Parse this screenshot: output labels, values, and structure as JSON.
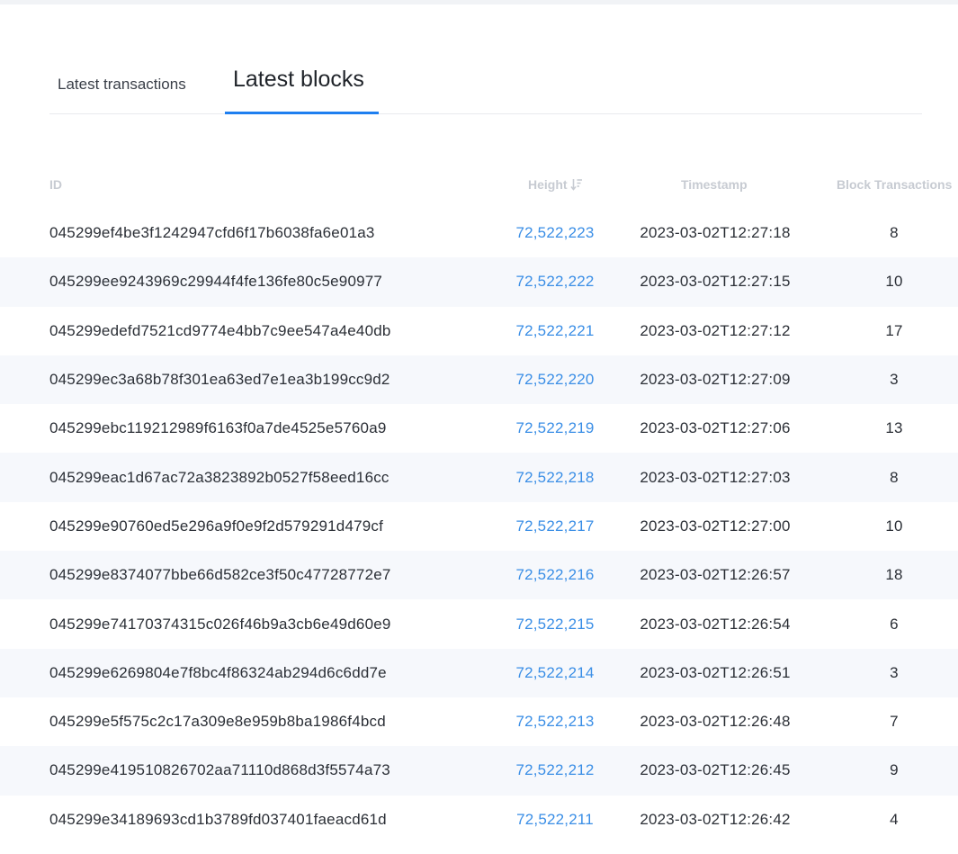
{
  "tabs": {
    "transactions_label": "Latest transactions",
    "blocks_label": "Latest blocks",
    "active": "blocks"
  },
  "table": {
    "headers": {
      "id": "ID",
      "height": "Height",
      "timestamp": "Timestamp",
      "transactions": "Block Transactions"
    },
    "sort_icon": "sort-descending-icon",
    "rows": [
      {
        "id": "045299ef4be3f1242947cfd6f17b6038fa6e01a3",
        "height": "72,522,223",
        "timestamp": "2023-03-02T12:27:18",
        "tx": "8"
      },
      {
        "id": "045299ee9243969c29944f4fe136fe80c5e90977",
        "height": "72,522,222",
        "timestamp": "2023-03-02T12:27:15",
        "tx": "10"
      },
      {
        "id": "045299edefd7521cd9774e4bb7c9ee547a4e40db",
        "height": "72,522,221",
        "timestamp": "2023-03-02T12:27:12",
        "tx": "17"
      },
      {
        "id": "045299ec3a68b78f301ea63ed7e1ea3b199cc9d2",
        "height": "72,522,220",
        "timestamp": "2023-03-02T12:27:09",
        "tx": "3"
      },
      {
        "id": "045299ebc119212989f6163f0a7de4525e5760a9",
        "height": "72,522,219",
        "timestamp": "2023-03-02T12:27:06",
        "tx": "13"
      },
      {
        "id": "045299eac1d67ac72a3823892b0527f58eed16cc",
        "height": "72,522,218",
        "timestamp": "2023-03-02T12:27:03",
        "tx": "8"
      },
      {
        "id": "045299e90760ed5e296a9f0e9f2d579291d479cf",
        "height": "72,522,217",
        "timestamp": "2023-03-02T12:27:00",
        "tx": "10"
      },
      {
        "id": "045299e8374077bbe66d582ce3f50c47728772e7",
        "height": "72,522,216",
        "timestamp": "2023-03-02T12:26:57",
        "tx": "18"
      },
      {
        "id": "045299e74170374315c026f46b9a3cb6e49d60e9",
        "height": "72,522,215",
        "timestamp": "2023-03-02T12:26:54",
        "tx": "6"
      },
      {
        "id": "045299e6269804e7f8bc4f86324ab294d6c6dd7e",
        "height": "72,522,214",
        "timestamp": "2023-03-02T12:26:51",
        "tx": "3"
      },
      {
        "id": "045299e5f575c2c17a309e8e959b8ba1986f4bcd",
        "height": "72,522,213",
        "timestamp": "2023-03-02T12:26:48",
        "tx": "7"
      },
      {
        "id": "045299e419510826702aa71110d868d3f5574a73",
        "height": "72,522,212",
        "timestamp": "2023-03-02T12:26:45",
        "tx": "9"
      },
      {
        "id": "045299e34189693cd1b3789fd037401faeacd61d",
        "height": "72,522,211",
        "timestamp": "2023-03-02T12:26:42",
        "tx": "4"
      }
    ]
  },
  "colors": {
    "accent": "#1e7ff0",
    "link": "#3a8ee6",
    "stripe": "#f6f8fc",
    "header_text": "#c7cbd2"
  }
}
